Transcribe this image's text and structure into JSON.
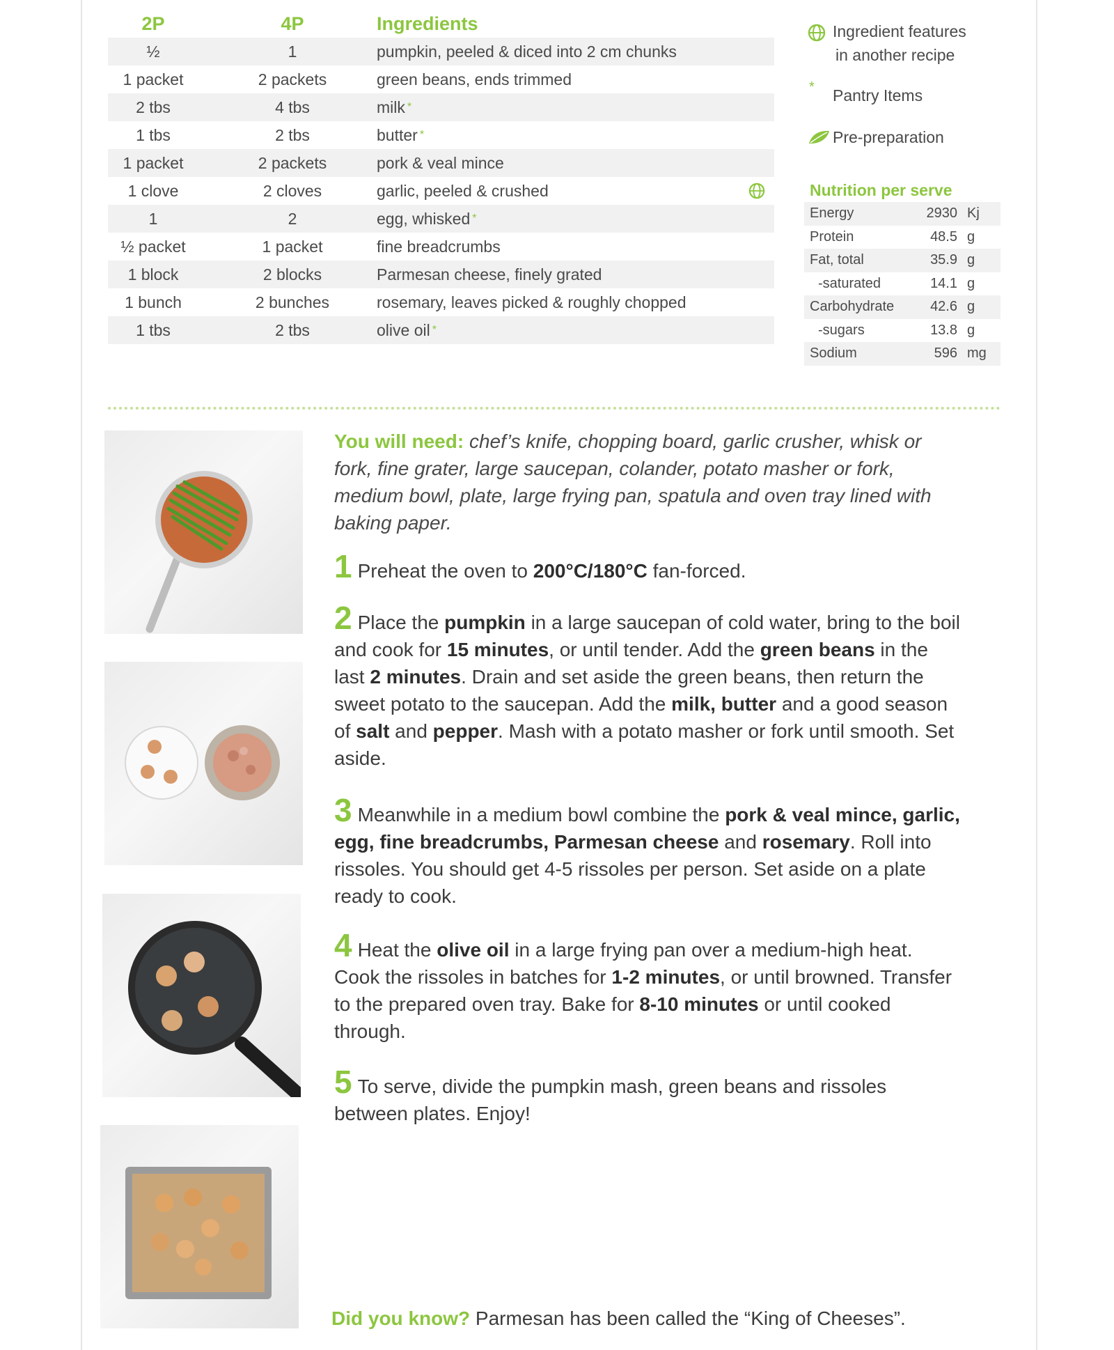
{
  "ingredients": {
    "headers": {
      "col_2p": "2P",
      "col_4p": "4P",
      "col_name": "Ingredients"
    },
    "rows": [
      {
        "p2": "½",
        "p4": "1",
        "name": "pumpkin, peeled & diced into 2 cm chunks",
        "pantry": false,
        "features": false
      },
      {
        "p2": "1 packet",
        "p4": "2 packets",
        "name": "green beans, ends trimmed",
        "pantry": false,
        "features": false
      },
      {
        "p2": "2 tbs",
        "p4": "4 tbs",
        "name": "milk",
        "pantry": true,
        "features": false
      },
      {
        "p2": "1 tbs",
        "p4": "2 tbs",
        "name": "butter",
        "pantry": true,
        "features": false
      },
      {
        "p2": "1 packet",
        "p4": "2 packets",
        "name": "pork & veal mince",
        "pantry": false,
        "features": false
      },
      {
        "p2": "1 clove",
        "p4": "2 cloves",
        "name": "garlic, peeled & crushed",
        "pantry": false,
        "features": true
      },
      {
        "p2": "1",
        "p4": "2",
        "name": "egg, whisked",
        "pantry": true,
        "features": false
      },
      {
        "p2": "½ packet",
        "p4": "1 packet",
        "name": "fine breadcrumbs",
        "pantry": false,
        "features": false
      },
      {
        "p2": "1 block",
        "p4": "2 blocks",
        "name": "Parmesan cheese, finely grated",
        "pantry": false,
        "features": false
      },
      {
        "p2": "1 bunch",
        "p4": "2 bunches",
        "name": "rosemary, leaves picked & roughly chopped",
        "pantry": false,
        "features": false
      },
      {
        "p2": "1 tbs",
        "p4": "2 tbs",
        "name": "olive oil",
        "pantry": true,
        "features": false
      }
    ],
    "star_glyph": "*"
  },
  "legend": {
    "features_line1": "Ingredient features",
    "features_line2": "in another recipe",
    "pantry": "Pantry Items",
    "prep": "Pre-preparation"
  },
  "nutrition": {
    "title": "Nutrition per serve",
    "rows": [
      {
        "label": "Energy",
        "value": "2930",
        "unit": "Kj"
      },
      {
        "label": "Protein",
        "value": "48.5",
        "unit": "g"
      },
      {
        "label": "Fat, total",
        "value": "35.9",
        "unit": "g"
      },
      {
        "label": "-saturated",
        "value": "14.1",
        "unit": "g"
      },
      {
        "label": "Carbohydrate",
        "value": "42.6",
        "unit": "g"
      },
      {
        "label": "-sugars",
        "value": "13.8",
        "unit": "g"
      },
      {
        "label": "Sodium",
        "value": "596",
        "unit": "mg"
      }
    ]
  },
  "photos": [
    {
      "label": "2",
      "depicts": "saucepan with green beans and pumpkin"
    },
    {
      "label": "3",
      "depicts": "bowls with rissoles and mince mixture"
    },
    {
      "label": "4a",
      "depicts": "frying pan with rissoles"
    },
    {
      "label": "4b",
      "depicts": "oven tray with rissoles"
    }
  ],
  "method": {
    "you_will_need_label": "You will need:",
    "you_will_need_text": "chef’s knife, chopping board, garlic crusher, whisk or fork, fine grater, large saucepan, colander, potato masher or fork, medium bowl, plate, large frying pan, spatula and oven tray lined with baking paper.",
    "steps": [
      {
        "num": "1",
        "s": [
          "Preheat the oven to ",
          "200°C/180°C",
          " fan-forced."
        ]
      },
      {
        "num": "2",
        "s": [
          "Place the ",
          "pumpkin",
          " in a large saucepan of cold water, bring to the boil and cook for ",
          "15 minutes",
          ", or until tender. Add the ",
          "green beans",
          " in the last ",
          "2 minutes",
          ". Drain and set aside the green beans, then return the sweet potato to the saucepan. Add the ",
          "milk, butter",
          " and a good season of ",
          "salt",
          " and ",
          "pepper",
          ". Mash with a potato masher or fork until smooth. Set aside."
        ]
      },
      {
        "num": "3",
        "s": [
          "Meanwhile in a medium bowl combine the ",
          "pork & veal mince, garlic, egg, fine breadcrumbs, Parmesan cheese",
          " and ",
          "rosemary",
          ". Roll into rissoles. You should get 4-5 rissoles per person. Set aside on a plate ready to cook."
        ]
      },
      {
        "num": "4",
        "s": [
          "Heat the ",
          "olive oil",
          " in a large frying pan over a medium-high heat. Cook the rissoles in batches for ",
          "1-2 minutes",
          ", or until browned. Transfer to the prepared oven tray. Bake for ",
          "8-10 minutes",
          " or until cooked through."
        ]
      },
      {
        "num": "5",
        "s": [
          "To serve, divide the pumpkin mash, green beans and rissoles between plates. Enjoy!"
        ]
      }
    ]
  },
  "did_you_know": {
    "label": "Did you know?",
    "text": "Parmesan has been called the “King of Cheeses”."
  },
  "colors": {
    "accent": "#8cc63f",
    "text": "#3c3c3c",
    "shade": "#f1f1f1"
  }
}
